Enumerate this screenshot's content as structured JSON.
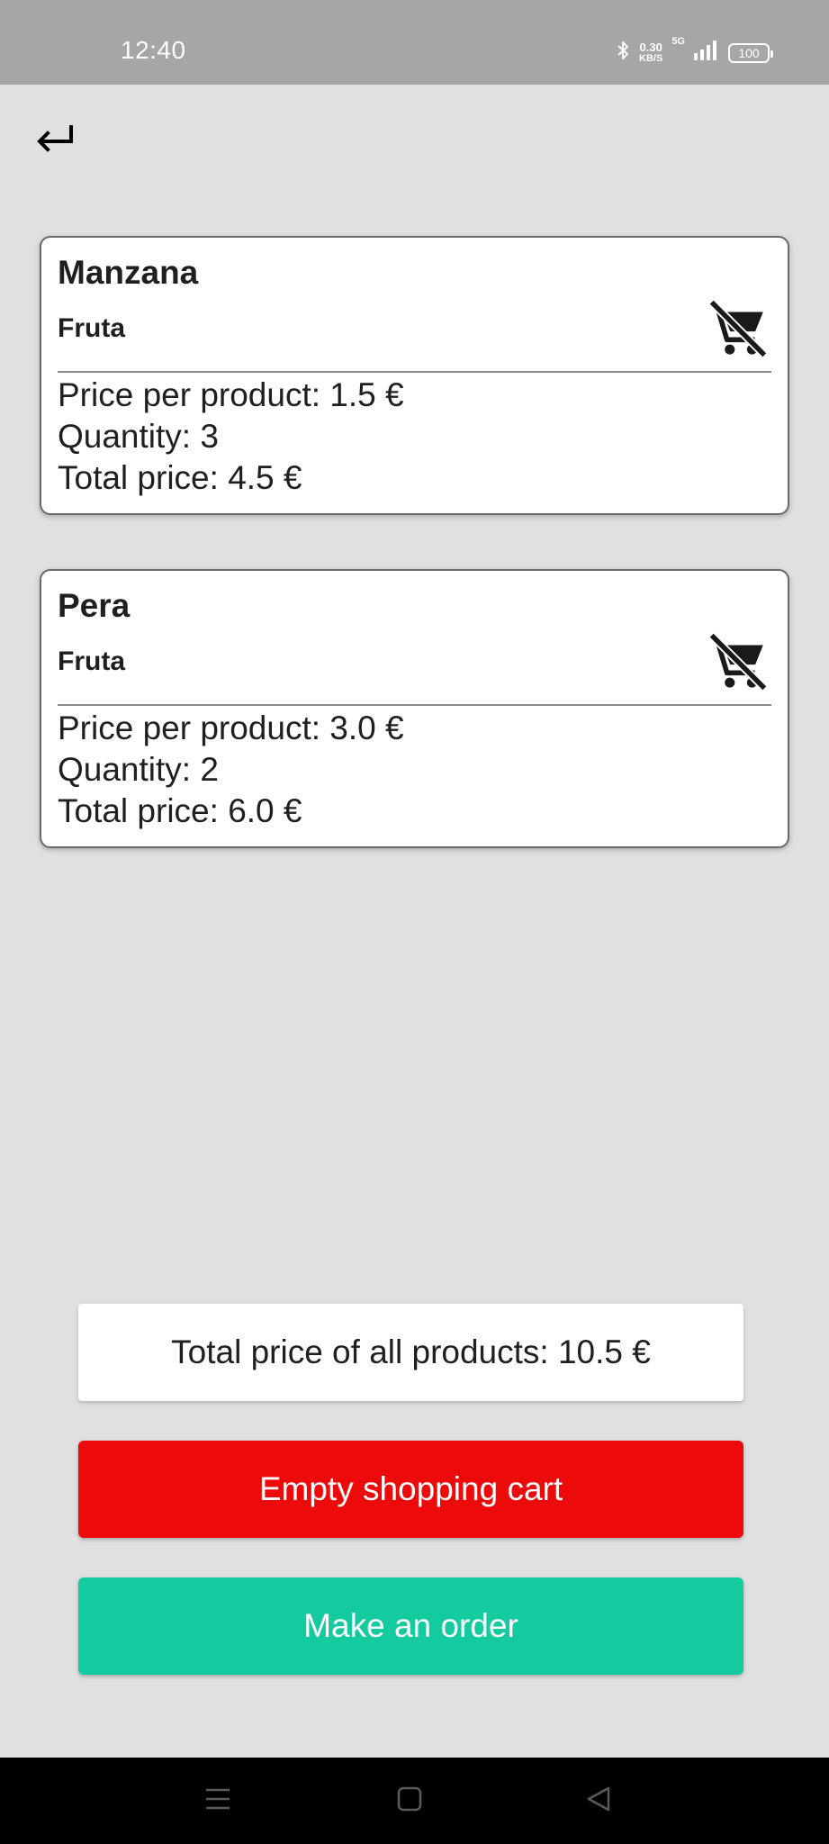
{
  "status_bar": {
    "time": "12:40",
    "net_speed_value": "0.30",
    "net_speed_unit": "KB/S",
    "network_type": "5G",
    "battery": "100",
    "icons": [
      "bluetooth-icon",
      "signal-icon",
      "battery-icon"
    ]
  },
  "header": {
    "back_icon": "return-arrow-icon"
  },
  "cart_items": [
    {
      "name": "Manzana",
      "category": "Fruta",
      "price_line": "Price per product: 1.5 €",
      "quantity_line": "Quantity: 3",
      "total_line": "Total price: 4.5 €",
      "remove_icon": "remove-from-cart-icon"
    },
    {
      "name": "Pera",
      "category": "Fruta",
      "price_line": "Price per product: 3.0 €",
      "quantity_line": "Quantity: 2",
      "total_line": "Total price: 6.0 €",
      "remove_icon": "remove-from-cart-icon"
    }
  ],
  "summary": {
    "total_label": "Total price of all products: 10.5 €"
  },
  "actions": {
    "empty_cart_label": "Empty shopping cart",
    "make_order_label": "Make an order"
  },
  "colors": {
    "background": "#e0e0e0",
    "status_bar": "#a6a6a6",
    "empty_button": "#ec0a0a",
    "order_button": "#13cb9e",
    "nav_bar": "#000000"
  },
  "nav_bar": {
    "icons": [
      "menu-icon",
      "home-icon",
      "back-icon"
    ]
  }
}
